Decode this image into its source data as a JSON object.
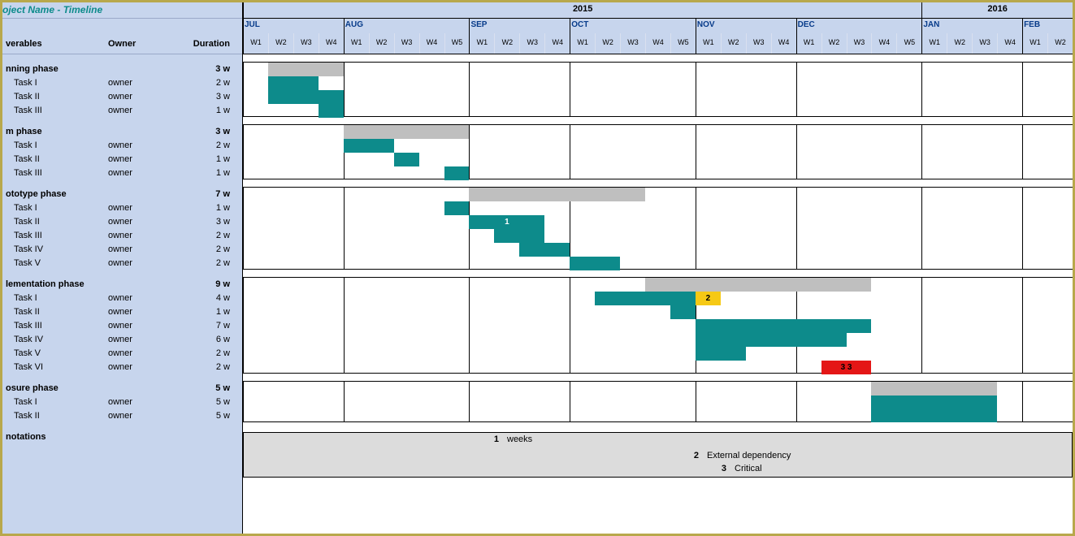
{
  "title": "oject Name - Timeline",
  "left_headers": {
    "deliverables": "verables",
    "owner": "Owner",
    "duration": "Duration"
  },
  "years": [
    {
      "label": "2015",
      "weeks": 27
    },
    {
      "label": "2016",
      "weeks": 6
    }
  ],
  "months": [
    {
      "label": "JUL",
      "weeks": 4,
      "first_week_global": 0
    },
    {
      "label": "AUG",
      "weeks": 5,
      "first_week_global": 4
    },
    {
      "label": "SEP",
      "weeks": 4,
      "first_week_global": 9
    },
    {
      "label": "OCT",
      "weeks": 5,
      "first_week_global": 13
    },
    {
      "label": "NOV",
      "weeks": 4,
      "first_week_global": 18
    },
    {
      "label": "DEC",
      "weeks": 5,
      "first_week_global": 22
    },
    {
      "label": "JAN",
      "weeks": 4,
      "first_week_global": 27
    },
    {
      "label": "FEB",
      "weeks": 2,
      "first_week_global": 31
    }
  ],
  "week_labels": [
    "W1",
    "W2",
    "W3",
    "W4",
    "W1",
    "W2",
    "W3",
    "W4",
    "W5",
    "W1",
    "W2",
    "W3",
    "W4",
    "W1",
    "W2",
    "W3",
    "W4",
    "W5",
    "W1",
    "W2",
    "W3",
    "W4",
    "W1",
    "W2",
    "W3",
    "W4",
    "W5",
    "W1",
    "W2",
    "W3",
    "W4",
    "W1",
    "W2"
  ],
  "total_weeks": 33,
  "phases": [
    {
      "name": "nning phase",
      "duration": "3 w",
      "summary": {
        "start": 1,
        "span": 3
      },
      "tasks": [
        {
          "name": "Task I",
          "owner": "owner",
          "duration": "2 w",
          "bar": {
            "start": 1,
            "span": 2,
            "type": "task"
          }
        },
        {
          "name": "Task II",
          "owner": "owner",
          "duration": "3 w",
          "bar": {
            "start": 1,
            "span": 3,
            "type": "task"
          }
        },
        {
          "name": "Task III",
          "owner": "owner",
          "duration": "1 w",
          "bar": {
            "start": 3,
            "span": 1,
            "type": "task"
          }
        }
      ]
    },
    {
      "name": "m phase",
      "duration": "3 w",
      "summary": {
        "start": 4,
        "span": 5
      },
      "tasks": [
        {
          "name": "Task I",
          "owner": "owner",
          "duration": "2 w",
          "bar": {
            "start": 4,
            "span": 2,
            "type": "task"
          }
        },
        {
          "name": "Task II",
          "owner": "owner",
          "duration": "1 w",
          "bar": {
            "start": 6,
            "span": 1,
            "type": "task"
          }
        },
        {
          "name": "Task III",
          "owner": "owner",
          "duration": "1 w",
          "bar": {
            "start": 8,
            "span": 1,
            "type": "task"
          }
        }
      ]
    },
    {
      "name": "ototype phase",
      "duration": "7 w",
      "summary": {
        "start": 9,
        "span": 7
      },
      "tasks": [
        {
          "name": "Task I",
          "owner": "owner",
          "duration": "1 w",
          "bar": {
            "start": 8,
            "span": 1,
            "type": "task"
          }
        },
        {
          "name": "Task II",
          "owner": "owner",
          "duration": "3 w",
          "bar": {
            "start": 9,
            "span": 3,
            "type": "task",
            "label": "1"
          }
        },
        {
          "name": "Task III",
          "owner": "owner",
          "duration": "2 w",
          "bar": {
            "start": 10,
            "span": 2,
            "type": "task"
          }
        },
        {
          "name": "Task IV",
          "owner": "owner",
          "duration": "2 w",
          "bar": {
            "start": 11,
            "span": 2,
            "type": "task"
          }
        },
        {
          "name": "Task V",
          "owner": "owner",
          "duration": "2 w",
          "bar": {
            "start": 13,
            "span": 2,
            "type": "task"
          }
        }
      ]
    },
    {
      "name": "lementation phase",
      "duration": "9 w",
      "summary": {
        "start": 16,
        "span": 9
      },
      "tasks": [
        {
          "name": "Task I",
          "owner": "owner",
          "duration": "4 w",
          "bar": {
            "start": 14,
            "span": 4,
            "type": "task"
          },
          "extra": {
            "start": 18,
            "span": 1,
            "type": "extdep",
            "label": "2"
          }
        },
        {
          "name": "Task II",
          "owner": "owner",
          "duration": "1 w",
          "bar": {
            "start": 17,
            "span": 1,
            "type": "task"
          }
        },
        {
          "name": "Task III",
          "owner": "owner",
          "duration": "7 w",
          "bar": {
            "start": 18,
            "span": 7,
            "type": "task"
          }
        },
        {
          "name": "Task IV",
          "owner": "owner",
          "duration": "6 w",
          "bar": {
            "start": 18,
            "span": 6,
            "type": "task"
          }
        },
        {
          "name": "Task V",
          "owner": "owner",
          "duration": "2 w",
          "bar": {
            "start": 18,
            "span": 2,
            "type": "task"
          }
        },
        {
          "name": "Task VI",
          "owner": "owner",
          "duration": "2 w",
          "bar": {
            "start": 23,
            "span": 2,
            "type": "crit",
            "label": "3    3"
          }
        }
      ]
    },
    {
      "name": "osure phase",
      "duration": "5 w",
      "summary": {
        "start": 25,
        "span": 5
      },
      "tasks": [
        {
          "name": "Task I",
          "owner": "owner",
          "duration": "5 w",
          "bar": {
            "start": 25,
            "span": 5,
            "type": "task"
          }
        },
        {
          "name": "Task II",
          "owner": "owner",
          "duration": "5 w",
          "bar": {
            "start": 25,
            "span": 5,
            "type": "task"
          }
        }
      ]
    }
  ],
  "annotations_label": "notations",
  "annotations": [
    {
      "key": "1",
      "text": "weeks"
    },
    {
      "key": "2",
      "text": "External dependency"
    },
    {
      "key": "3",
      "text": "Critical"
    }
  ],
  "colors": {
    "summary": "#bfbfbf",
    "task": "#0d8b8b",
    "extdep": "#f6c915",
    "crit": "#e41616",
    "panel": "#c7d5ed"
  },
  "chart_data": {
    "type": "bar",
    "orientation": "gantt",
    "x_axis": "weeks (Jul 2015 – Feb 2016)",
    "categories": [
      "JUL",
      "AUG",
      "SEP",
      "OCT",
      "NOV",
      "DEC",
      "JAN",
      "FEB"
    ],
    "series": [
      {
        "name": "nning phase (summary)",
        "start_week": 1,
        "duration_weeks": 3
      },
      {
        "name": "nning • Task I",
        "start_week": 1,
        "duration_weeks": 2
      },
      {
        "name": "nning • Task II",
        "start_week": 1,
        "duration_weeks": 3
      },
      {
        "name": "nning • Task III",
        "start_week": 3,
        "duration_weeks": 1
      },
      {
        "name": "m phase (summary)",
        "start_week": 4,
        "duration_weeks": 5
      },
      {
        "name": "m • Task I",
        "start_week": 4,
        "duration_weeks": 2
      },
      {
        "name": "m • Task II",
        "start_week": 6,
        "duration_weeks": 1
      },
      {
        "name": "m • Task III",
        "start_week": 8,
        "duration_weeks": 1
      },
      {
        "name": "ototype phase (summary)",
        "start_week": 9,
        "duration_weeks": 7
      },
      {
        "name": "ototype • Task I",
        "start_week": 8,
        "duration_weeks": 1
      },
      {
        "name": "ototype • Task II",
        "start_week": 9,
        "duration_weeks": 3,
        "note": "1"
      },
      {
        "name": "ototype • Task III",
        "start_week": 10,
        "duration_weeks": 2
      },
      {
        "name": "ototype • Task IV",
        "start_week": 11,
        "duration_weeks": 2
      },
      {
        "name": "ototype • Task V",
        "start_week": 13,
        "duration_weeks": 2
      },
      {
        "name": "lementation phase (summary)",
        "start_week": 16,
        "duration_weeks": 9
      },
      {
        "name": "lementation • Task I",
        "start_week": 14,
        "duration_weeks": 4,
        "ext_dep_at_week": 18
      },
      {
        "name": "lementation • Task II",
        "start_week": 17,
        "duration_weeks": 1
      },
      {
        "name": "lementation • Task III",
        "start_week": 18,
        "duration_weeks": 7
      },
      {
        "name": "lementation • Task IV",
        "start_week": 18,
        "duration_weeks": 6
      },
      {
        "name": "lementation • Task V",
        "start_week": 18,
        "duration_weeks": 2
      },
      {
        "name": "lementation • Task VI",
        "start_week": 23,
        "duration_weeks": 2,
        "critical": true
      },
      {
        "name": "osure phase (summary)",
        "start_week": 25,
        "duration_weeks": 5
      },
      {
        "name": "osure • Task I",
        "start_week": 25,
        "duration_weeks": 5
      },
      {
        "name": "osure • Task II",
        "start_week": 25,
        "duration_weeks": 5
      }
    ],
    "legend": {
      "1": "weeks",
      "2": "External dependency",
      "3": "Critical"
    }
  }
}
